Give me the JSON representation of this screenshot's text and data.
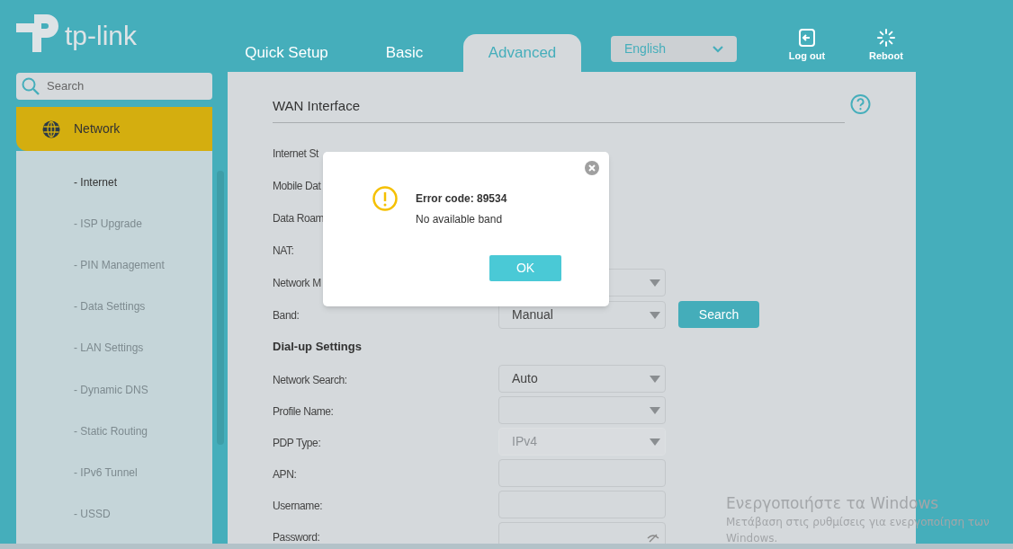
{
  "header": {
    "logo": "tp-link",
    "tabs": [
      {
        "label": "Quick Setup",
        "selected": false
      },
      {
        "label": "Basic",
        "selected": false
      },
      {
        "label": "Advanced",
        "selected": true
      }
    ],
    "language": "English",
    "actions": [
      {
        "kind": "logout",
        "label": "Log out"
      },
      {
        "kind": "reboot",
        "label": "Reboot"
      }
    ]
  },
  "sidebar": {
    "search": {
      "placeholder": "Search"
    },
    "section": {
      "label": "Network",
      "expanded": true
    },
    "items": [
      {
        "label": "- Internet",
        "selected": true
      },
      {
        "label": "- ISP Upgrade",
        "selected": false
      },
      {
        "label": "- PIN Management",
        "selected": false
      },
      {
        "label": "- Data Settings",
        "selected": false
      },
      {
        "label": "- LAN Settings",
        "selected": false
      },
      {
        "label": "- Dynamic DNS",
        "selected": false
      },
      {
        "label": "- Static Routing",
        "selected": false
      },
      {
        "label": "- IPv6 Tunnel",
        "selected": false
      },
      {
        "label": "- USSD",
        "selected": false
      }
    ]
  },
  "content": {
    "title": "WAN Interface",
    "rows": [
      {
        "kind": "label",
        "label": "Internet St"
      },
      {
        "kind": "label",
        "label": "Mobile Dat"
      },
      {
        "kind": "label",
        "label": "Data Roam"
      },
      {
        "kind": "label",
        "label": "NAT:"
      },
      {
        "kind": "select",
        "label": "Network M",
        "disabled": false
      },
      {
        "kind": "select",
        "label": "Band:",
        "value": "Manual",
        "button": "Search",
        "disabled": false
      },
      {
        "kind": "heading",
        "label": "Dial-up Settings"
      },
      {
        "kind": "select",
        "label": "Network Search:",
        "value": "Auto",
        "disabled": false
      },
      {
        "kind": "select",
        "label": "Profile Name:",
        "disabled": false
      },
      {
        "kind": "select",
        "label": "PDP Type:",
        "value": "IPv4",
        "disabled": true
      },
      {
        "kind": "input",
        "label": "APN:"
      },
      {
        "kind": "input",
        "label": "Username:"
      },
      {
        "kind": "password",
        "label": "Password:"
      }
    ]
  },
  "dialog": {
    "title": "Error code: 89534",
    "message": "No available band",
    "button": "OK"
  },
  "os_notice": {
    "title": "Ενεργοποιήστε τα Windows",
    "text": "Μετάβαση στις ρυθμίσεις για ενεργοποίηση των Windows."
  }
}
